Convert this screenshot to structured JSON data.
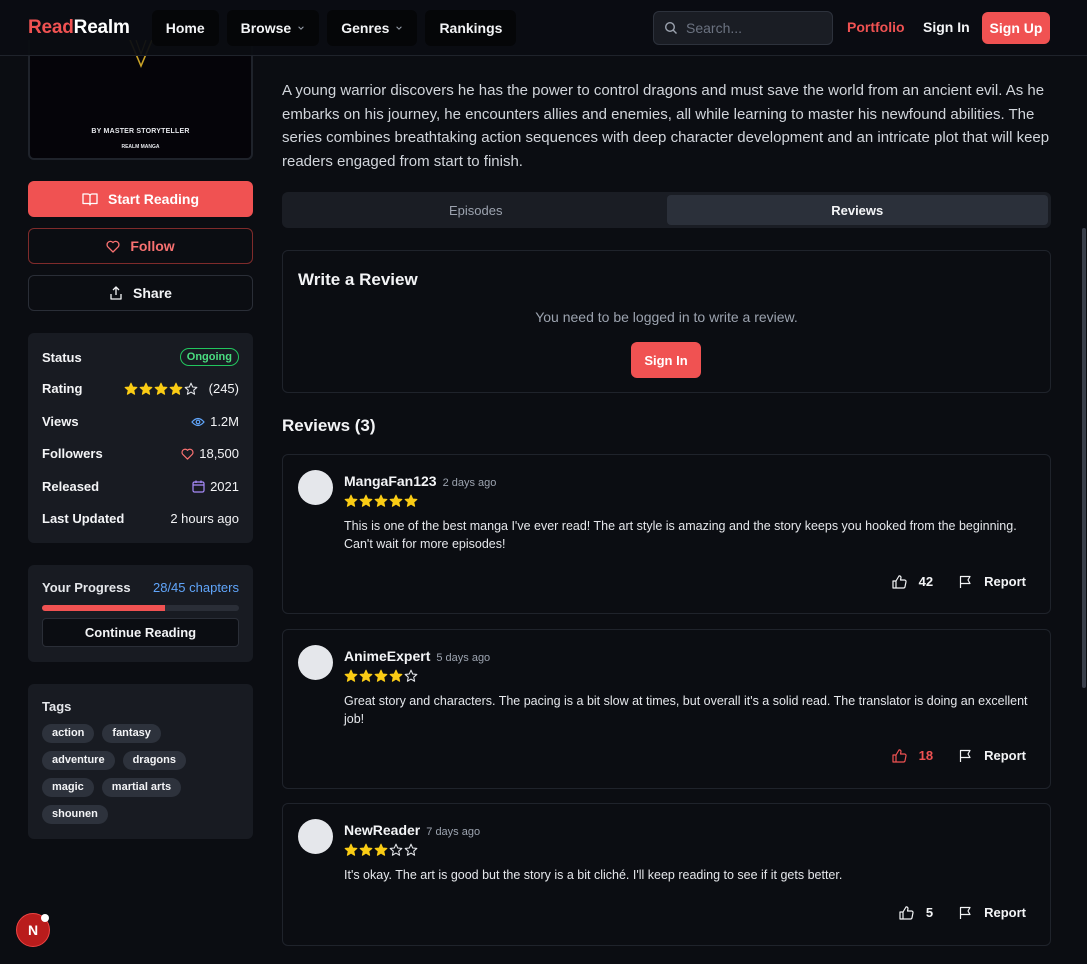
{
  "header": {
    "logo_a": "Read",
    "logo_b": "Realm",
    "nav": [
      "Home",
      "Browse",
      "Genres",
      "Rankings"
    ],
    "search_placeholder": "Search...",
    "portfolio": "Portfolio",
    "sign_in": "Sign In",
    "sign_up": "Sign Up"
  },
  "cover": {
    "author": "BY MASTER STORYTELLER",
    "publisher": "REALM MANGA"
  },
  "actions": {
    "start": "Start Reading",
    "follow": "Follow",
    "share": "Share"
  },
  "info": {
    "status_label": "Status",
    "status_value": "Ongoing",
    "rating_label": "Rating",
    "rating_stars": 4,
    "rating_count": "(245)",
    "views_label": "Views",
    "views_value": "1.2M",
    "followers_label": "Followers",
    "followers_value": "18,500",
    "released_label": "Released",
    "released_value": "2021",
    "updated_label": "Last Updated",
    "updated_value": "2 hours ago"
  },
  "progress": {
    "label": "Your Progress",
    "value": "28/45 chapters",
    "read": 28,
    "total": 45,
    "continue": "Continue Reading"
  },
  "tags": {
    "title": "Tags",
    "items": [
      "action",
      "fantasy",
      "adventure",
      "dragons",
      "magic",
      "martial arts",
      "shounen"
    ]
  },
  "description": "A young warrior discovers he has the power to control dragons and must save the world from an ancient evil. As he embarks on his journey, he encounters allies and enemies, all while learning to master his newfound abilities. The series combines breathtaking action sequences with deep character development and an intricate plot that will keep readers engaged from start to finish.",
  "tabs": {
    "episodes": "Episodes",
    "reviews": "Reviews"
  },
  "write_review": {
    "title": "Write a Review",
    "message": "You need to be logged in to write a review.",
    "button": "Sign In"
  },
  "reviews_title": "Reviews (3)",
  "reviews": [
    {
      "user": "MangaFan123",
      "time": "2 days ago",
      "stars": 5,
      "likes": "42",
      "liked": false,
      "report": "Report",
      "text": "This is one of the best manga I've ever read! The art style is amazing and the story keeps you hooked from the beginning. Can't wait for more episodes!"
    },
    {
      "user": "AnimeExpert",
      "time": "5 days ago",
      "stars": 4,
      "likes": "18",
      "liked": true,
      "report": "Report",
      "text": "Great story and characters. The pacing is a bit slow at times, but overall it's a solid read. The translator is doing an excellent job!"
    },
    {
      "user": "NewReader",
      "time": "7 days ago",
      "stars": 3,
      "likes": "5",
      "liked": false,
      "report": "Report",
      "text": "It's okay. The art is good but the story is a bit cliché. I'll keep reading to see if it gets better."
    }
  ],
  "dev_badge": "N",
  "colors": {
    "accent": "#f05252",
    "star": "#facc15",
    "link": "#60a5fa",
    "ongoing": "#4ade80"
  }
}
